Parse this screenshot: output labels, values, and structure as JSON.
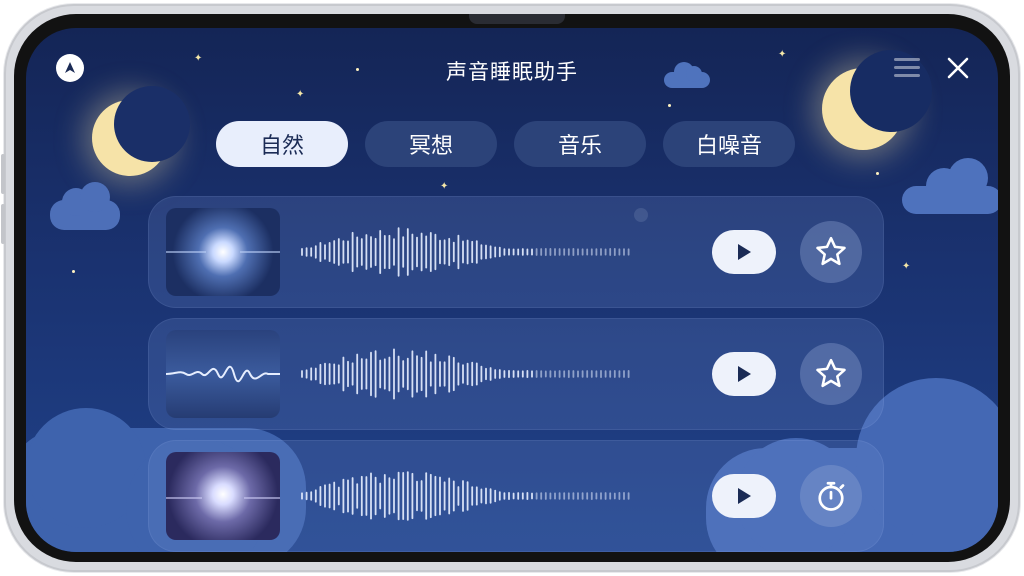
{
  "app": {
    "title": "声音睡眠助手"
  },
  "header": {
    "logo_icon": "logo-icon",
    "menu_icon": "menu-icon",
    "close_icon": "close-icon"
  },
  "tabs": [
    {
      "label": "自然",
      "active": true
    },
    {
      "label": "冥想",
      "active": false
    },
    {
      "label": "音乐",
      "active": false
    },
    {
      "label": "白噪音",
      "active": false
    }
  ],
  "tracks": [
    {
      "thumb_style": "orb",
      "play_icon": "play-icon",
      "action_icon": "star-icon"
    },
    {
      "thumb_style": "wave",
      "play_icon": "play-icon",
      "action_icon": "star-icon"
    },
    {
      "thumb_style": "orb-purple",
      "play_icon": "play-icon",
      "action_icon": "timer-icon"
    }
  ],
  "colors": {
    "accent": "#e8eefc",
    "background": "#1a3270",
    "moon": "#f6e3a8"
  }
}
